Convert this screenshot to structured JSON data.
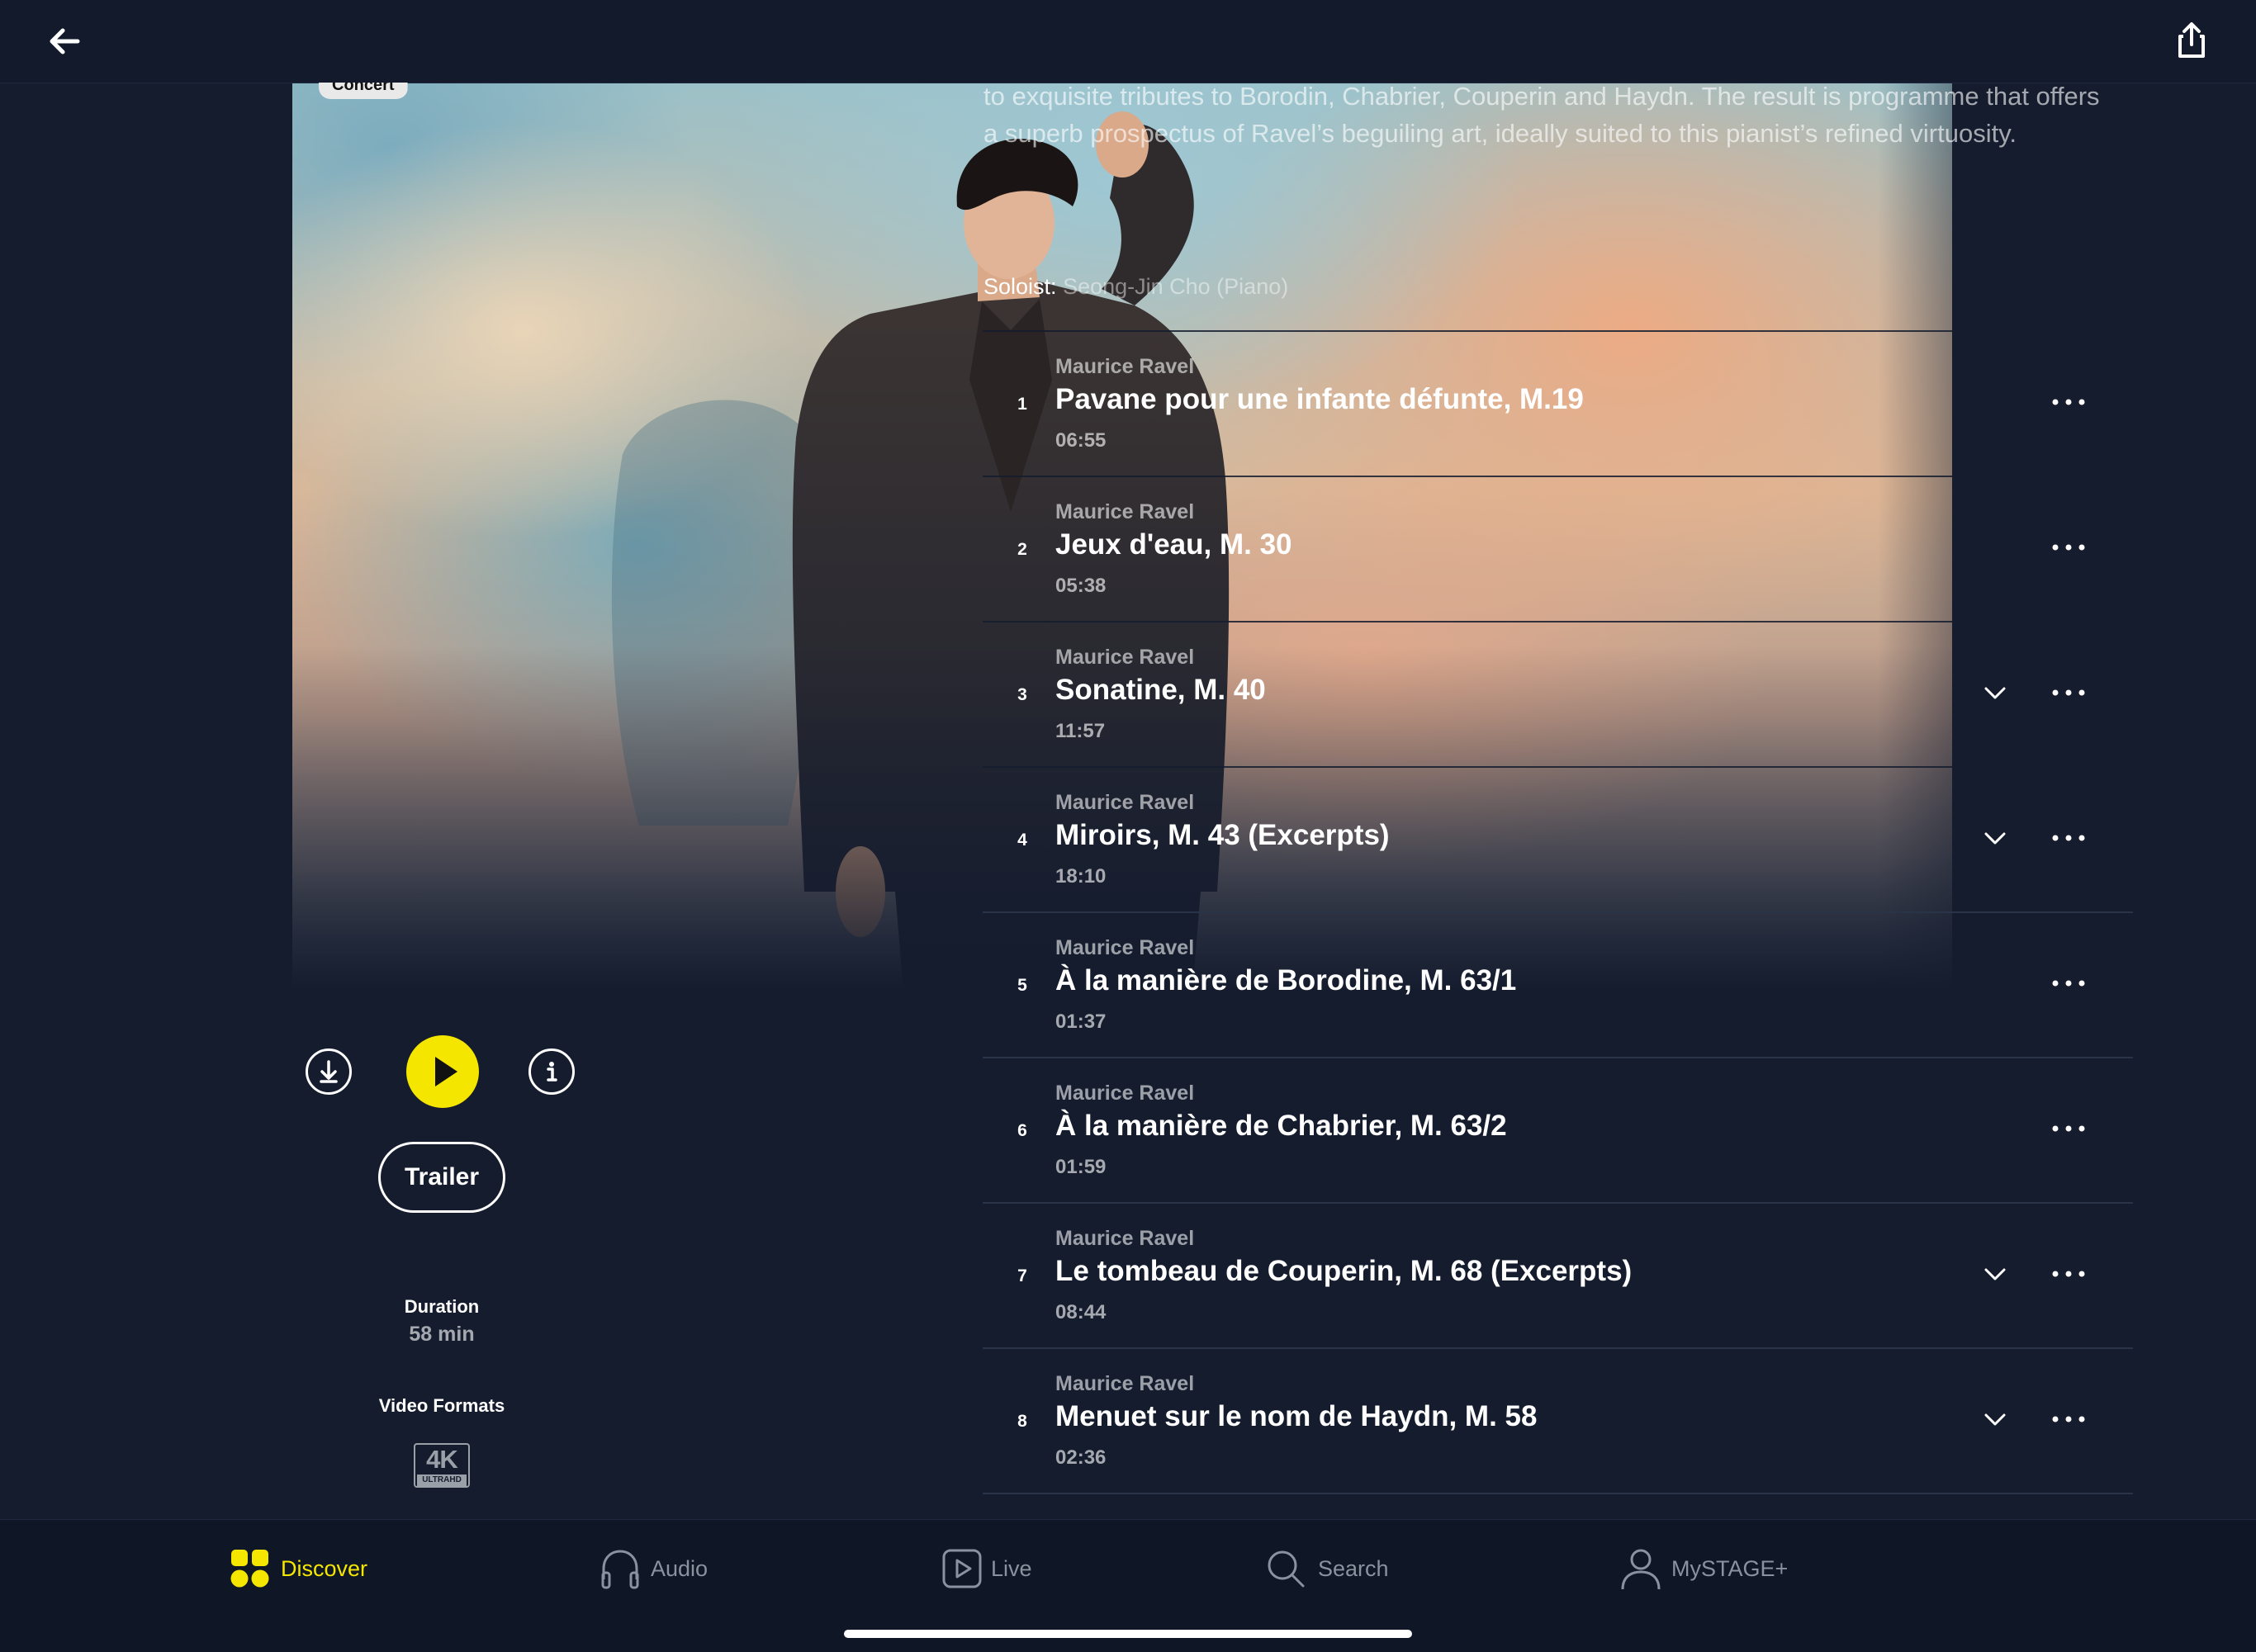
{
  "colors": {
    "background": "#141c2e",
    "accent": "#f5e600",
    "text_muted": "#8a92a0"
  },
  "header": {
    "back_icon": "arrow-left-icon",
    "share_icon": "share-icon"
  },
  "hero": {
    "category": "Concert"
  },
  "description": {
    "text": "to exquisite tributes to Borodin, Chabrier, Couperin and Haydn. The result is programme that offers a superb prospectus of Ravel’s beguiling art, ideally suited to this pianist’s refined virtuosity.",
    "soloist_label": "Soloist:",
    "soloist_value": "Seong-Jin Cho (Piano)"
  },
  "tracks": [
    {
      "num": "1",
      "composer": "Maurice Ravel",
      "title": "Pavane pour une infante défunte, M.19",
      "duration": "06:55",
      "expandable": false
    },
    {
      "num": "2",
      "composer": "Maurice Ravel",
      "title": "Jeux d'eau, M. 30",
      "duration": "05:38",
      "expandable": false
    },
    {
      "num": "3",
      "composer": "Maurice Ravel",
      "title": "Sonatine, M. 40",
      "duration": "11:57",
      "expandable": true
    },
    {
      "num": "4",
      "composer": "Maurice Ravel",
      "title": "Miroirs, M. 43 (Excerpts)",
      "duration": "18:10",
      "expandable": true
    },
    {
      "num": "5",
      "composer": "Maurice Ravel",
      "title": "À la manière de Borodine, M. 63/1",
      "duration": "01:37",
      "expandable": false
    },
    {
      "num": "6",
      "composer": "Maurice Ravel",
      "title": "À la manière de Chabrier, M. 63/2",
      "duration": "01:59",
      "expandable": false
    },
    {
      "num": "7",
      "composer": "Maurice Ravel",
      "title": "Le tombeau de Couperin, M. 68 (Excerpts)",
      "duration": "08:44",
      "expandable": true
    },
    {
      "num": "8",
      "composer": "Maurice Ravel",
      "title": "Menuet sur le nom de Haydn, M. 58",
      "duration": "02:36",
      "expandable": true
    }
  ],
  "actions": {
    "download_icon": "download-icon",
    "play_icon": "play-icon",
    "info_icon": "info-icon",
    "trailer_label": "Trailer"
  },
  "meta": {
    "duration_label": "Duration",
    "duration_value": "58 min",
    "formats_label": "Video Formats",
    "format_badge_main": "4K",
    "format_badge_sub": "ULTRAHD"
  },
  "nav": {
    "items": [
      {
        "label": "Discover",
        "icon": "grid-icon",
        "active": true
      },
      {
        "label": "Audio",
        "icon": "headphones-icon",
        "active": false
      },
      {
        "label": "Live",
        "icon": "live-play-icon",
        "active": false
      },
      {
        "label": "Search",
        "icon": "search-icon",
        "active": false
      },
      {
        "label": "MySTAGE+",
        "icon": "user-icon",
        "active": false
      }
    ]
  }
}
